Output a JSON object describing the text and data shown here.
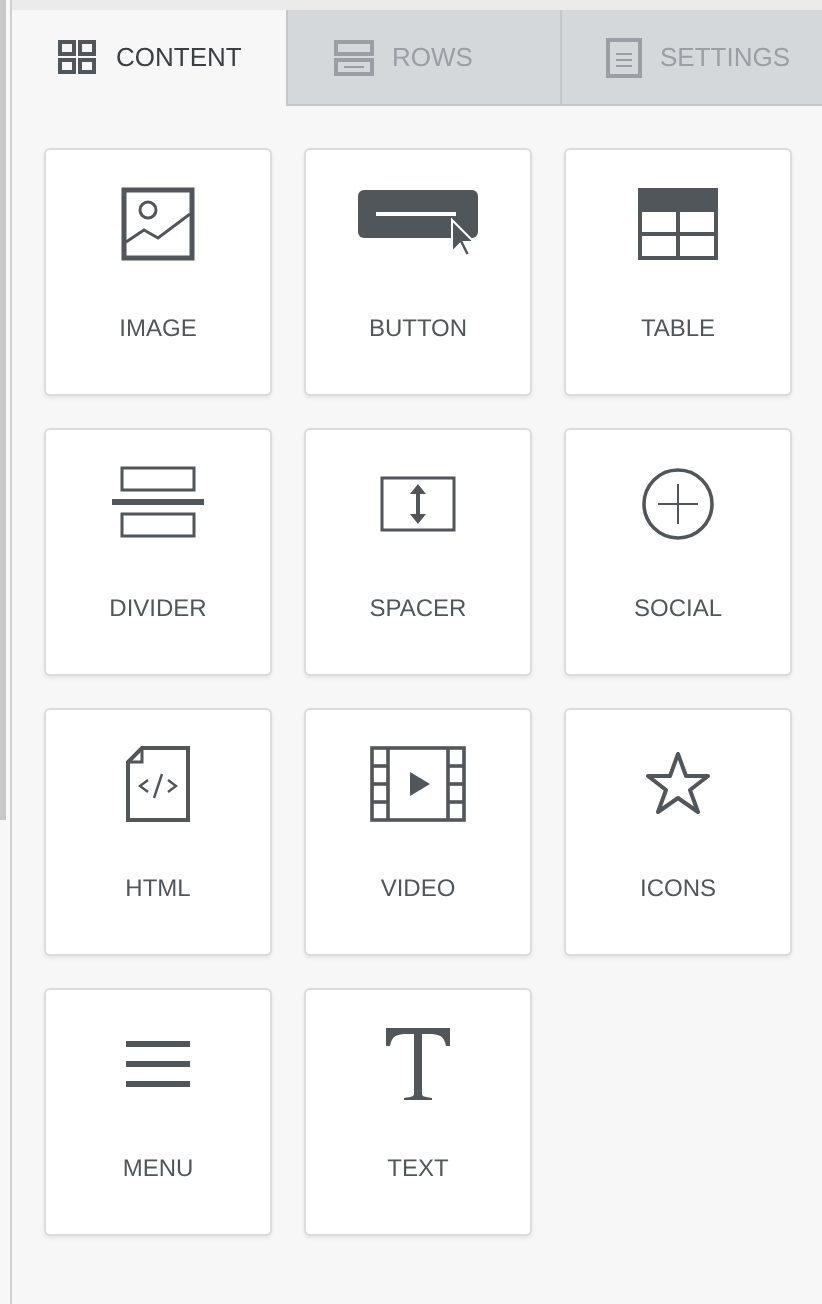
{
  "tabs": [
    {
      "label": "CONTENT",
      "kind": "content",
      "selected": true
    },
    {
      "label": "ROWS",
      "kind": "rows",
      "selected": false
    },
    {
      "label": "SETTINGS",
      "kind": "settings",
      "selected": false
    }
  ],
  "blocks": [
    {
      "kind": "image",
      "label": "IMAGE"
    },
    {
      "kind": "button",
      "label": "BUTTON"
    },
    {
      "kind": "table",
      "label": "TABLE"
    },
    {
      "kind": "divider",
      "label": "DIVIDER"
    },
    {
      "kind": "spacer",
      "label": "SPACER"
    },
    {
      "kind": "social",
      "label": "SOCIAL"
    },
    {
      "kind": "html",
      "label": "HTML"
    },
    {
      "kind": "video",
      "label": "VIDEO"
    },
    {
      "kind": "icons",
      "label": "ICONS"
    },
    {
      "kind": "menu",
      "label": "MENU"
    },
    {
      "kind": "text",
      "label": "TEXT"
    }
  ]
}
